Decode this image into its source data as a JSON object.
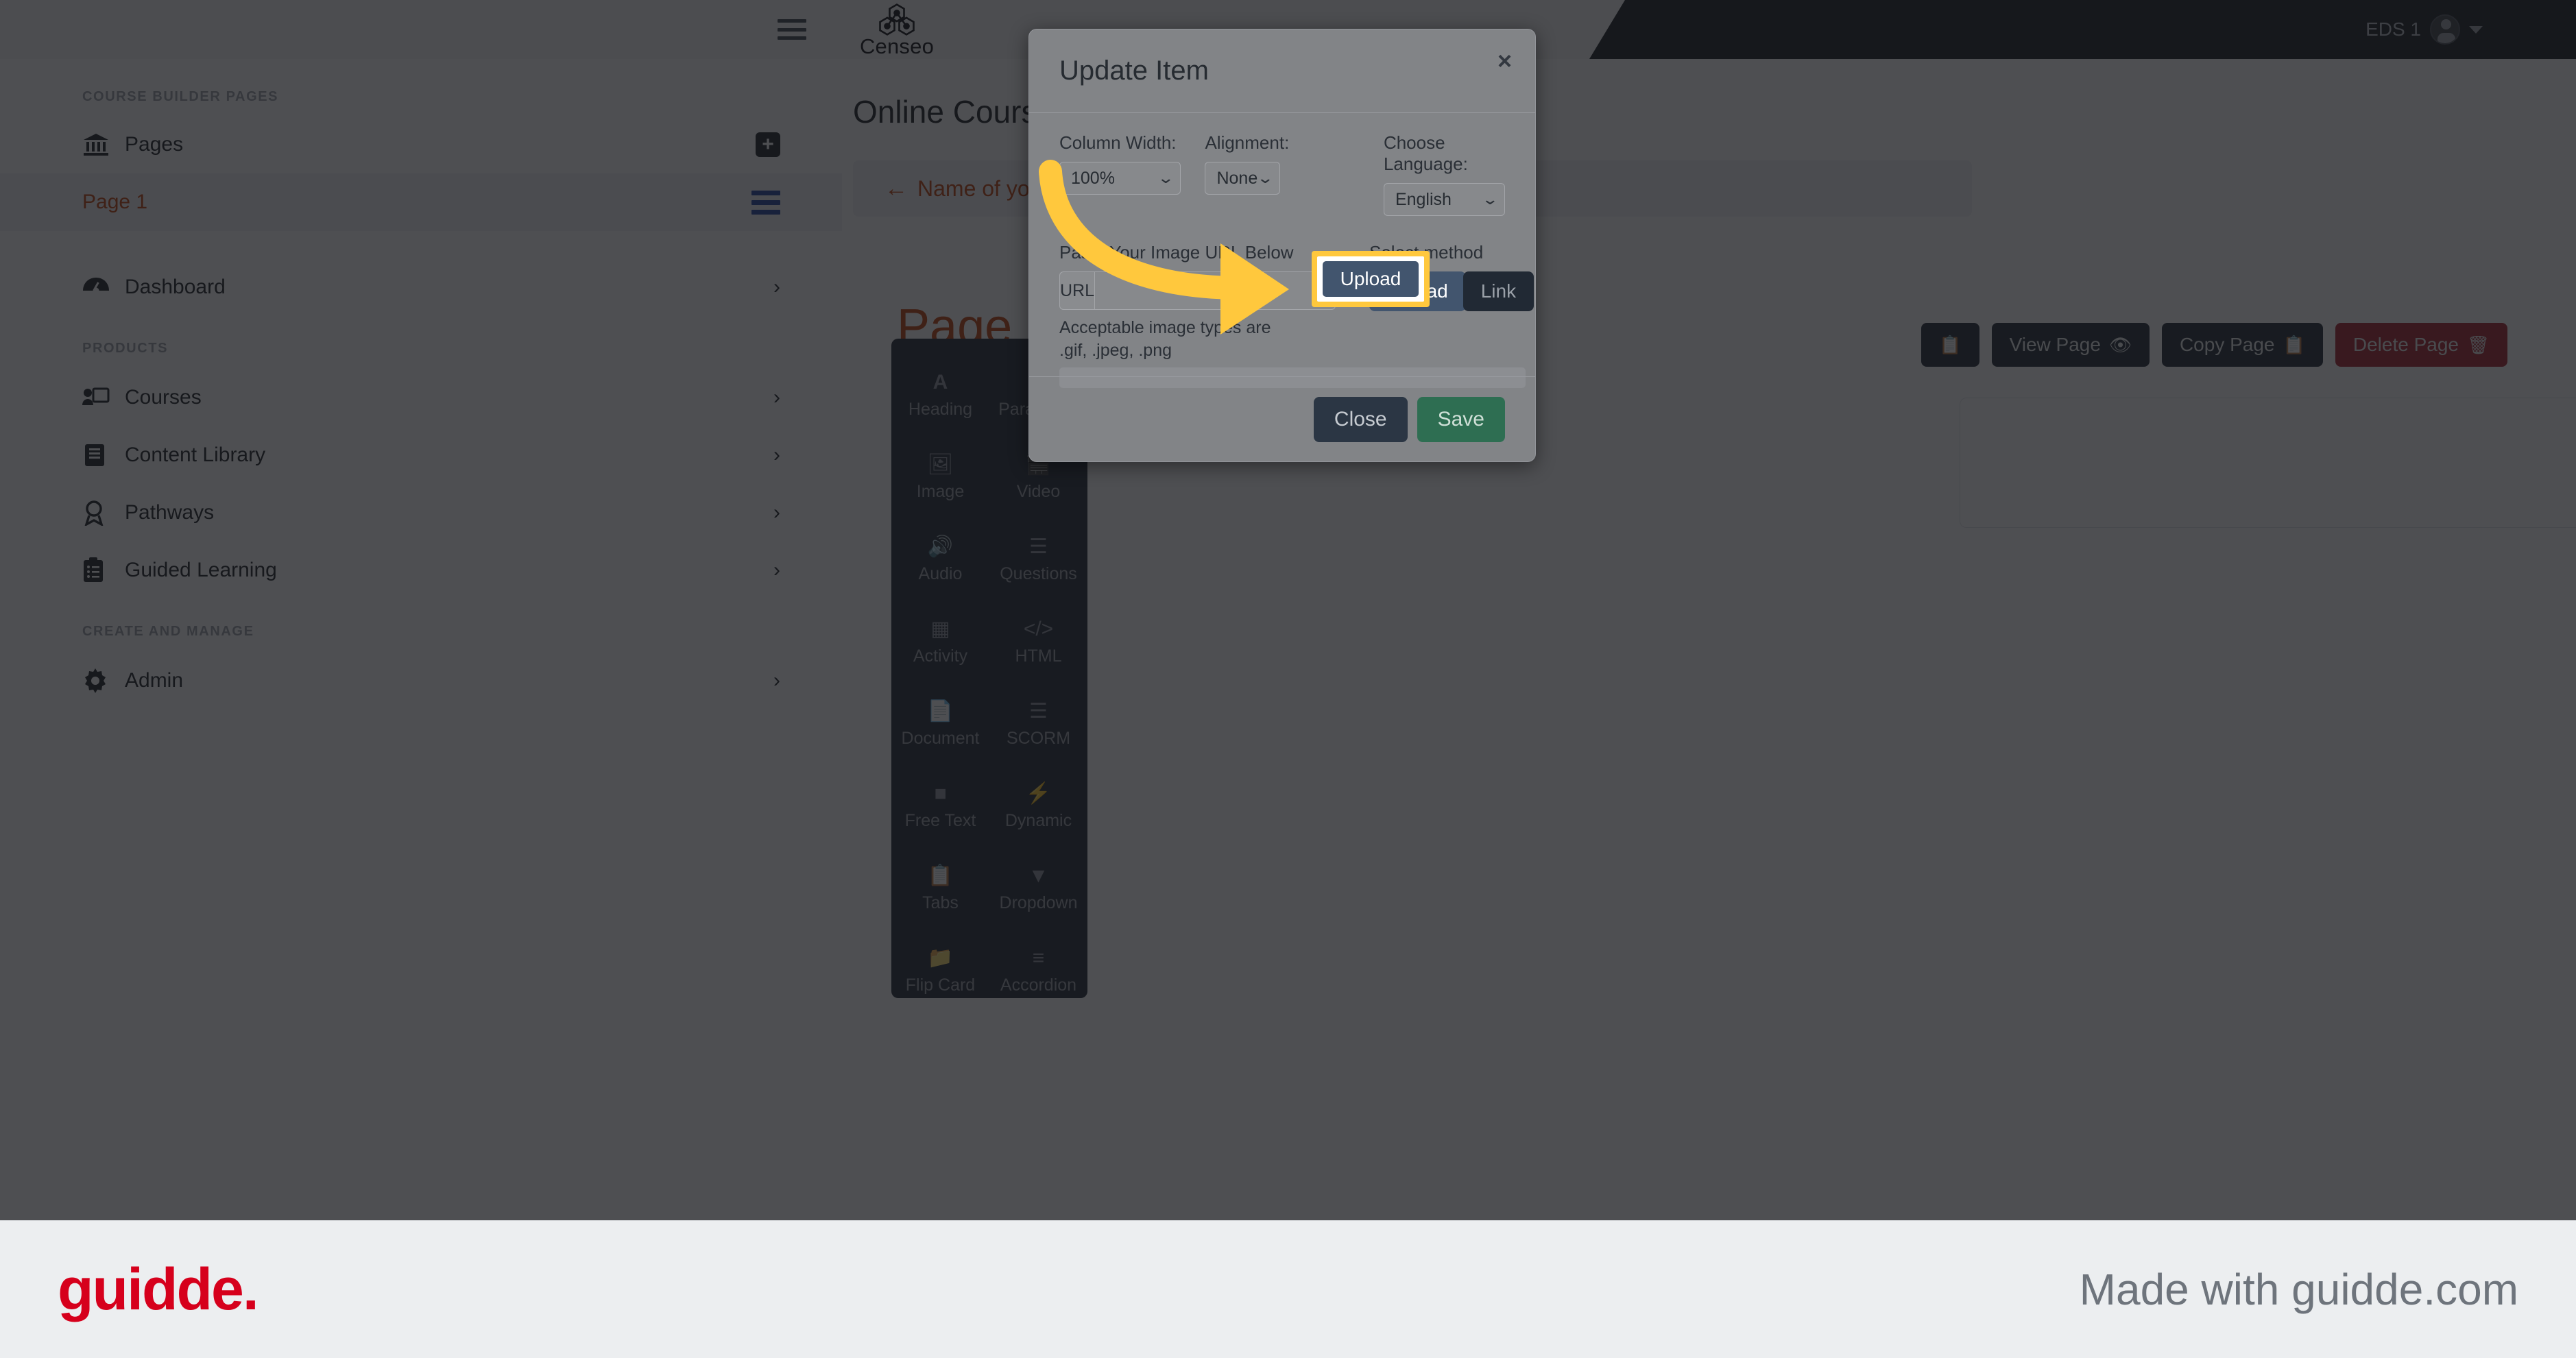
{
  "topbar": {
    "menu_icon": "hamburger-icon",
    "brand_name": "Censeo",
    "user_name": "EDS 1"
  },
  "sidebar": {
    "sections": [
      {
        "title": "COURSE BUILDER PAGES",
        "items": [
          {
            "label": "Pages",
            "icon": "bank-icon",
            "trailing": "plus-icon"
          },
          {
            "label": "Page 1",
            "icon": "",
            "trailing": "bars-icon",
            "active": true
          }
        ]
      },
      {
        "title": "",
        "items": [
          {
            "label": "Dashboard",
            "icon": "gauge-icon",
            "trailing": "chevron-right-icon"
          }
        ]
      },
      {
        "title": "PRODUCTS",
        "items": [
          {
            "label": "Courses",
            "icon": "presentation-icon",
            "trailing": "chevron-right-icon"
          },
          {
            "label": "Content Library",
            "icon": "book-icon",
            "trailing": "chevron-right-icon"
          },
          {
            "label": "Pathways",
            "icon": "award-icon",
            "trailing": "chevron-right-icon"
          },
          {
            "label": "Guided Learning",
            "icon": "clipboard-list-icon",
            "trailing": "chevron-right-icon"
          }
        ]
      },
      {
        "title": "CREATE AND MANAGE",
        "items": [
          {
            "label": "Admin",
            "icon": "gear-icon",
            "trailing": "chevron-right-icon"
          }
        ]
      }
    ]
  },
  "main": {
    "title": "Online Course Builder",
    "breadcrumb": {
      "arrow": "←",
      "label": "Name of your course"
    },
    "page_heading": "Page",
    "actions": [
      {
        "label": "",
        "icon": "copy-icon",
        "style": "dark"
      },
      {
        "label": "View Page",
        "icon": "eye-icon",
        "style": "dark"
      },
      {
        "label": "Copy Page",
        "icon": "copy-icon",
        "style": "dark"
      },
      {
        "label": "Delete Page",
        "icon": "trash-icon",
        "style": "danger"
      }
    ],
    "palette": [
      {
        "label": "Heading",
        "icon": "letter-a-icon"
      },
      {
        "label": "Paragraph",
        "icon": "paragraph-icon"
      },
      {
        "label": "Image",
        "icon": "image-icon"
      },
      {
        "label": "Video",
        "icon": "video-icon"
      },
      {
        "label": "Audio",
        "icon": "speaker-icon"
      },
      {
        "label": "Questions",
        "icon": "list-icon"
      },
      {
        "label": "Activity",
        "icon": "table-icon"
      },
      {
        "label": "HTML",
        "icon": "code-icon"
      },
      {
        "label": "Document",
        "icon": "file-icon"
      },
      {
        "label": "SCORM",
        "icon": "database-icon"
      },
      {
        "label": "Free Text",
        "icon": "square-icon"
      },
      {
        "label": "Dynamic",
        "icon": "bolt-icon"
      },
      {
        "label": "Tabs",
        "icon": "tabs-icon"
      },
      {
        "label": "Dropdown",
        "icon": "caret-down-icon"
      },
      {
        "label": "Flip Card",
        "icon": "folder-icon"
      },
      {
        "label": "Accordion",
        "icon": "lines-icon"
      }
    ]
  },
  "modal": {
    "title": "Update Item",
    "close_icon": "close-icon",
    "column_width": {
      "label": "Column Width:",
      "value": "100%"
    },
    "alignment": {
      "label": "Alignment:",
      "value": "None"
    },
    "language": {
      "label": "Choose Language:",
      "value": "English"
    },
    "url": {
      "label": "Paste Your Image URL Below",
      "addon": "URL",
      "value": "",
      "placeholder": "",
      "hint": "Acceptable image types are .gif, .jpeg, .png"
    },
    "method": {
      "label": "Select method",
      "upload_label": "Upload",
      "link_label": "Link"
    },
    "footer": {
      "close_label": "Close",
      "save_label": "Save"
    }
  },
  "highlight": {
    "button_label": "Upload",
    "box_color": "#ffc83d",
    "arrow_color": "#ffc83d"
  },
  "footer": {
    "logo_text": "guidde.",
    "tagline": "Made with guidde.com"
  }
}
